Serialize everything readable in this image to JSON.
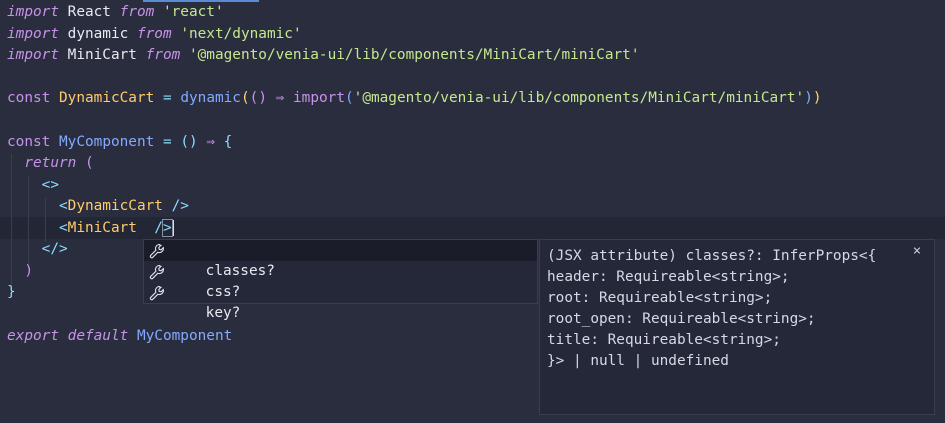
{
  "code": {
    "l1_kw": "import",
    "l1_name": "React",
    "l1_from": "from",
    "l1_str": "'react'",
    "l2_kw": "import",
    "l2_name": "dynamic",
    "l2_from": "from",
    "l2_str": "'next/dynamic'",
    "l3_kw": "import",
    "l3_name": "MiniCart",
    "l3_from": "from",
    "l3_str": "'@magento/venia-ui/lib/components/MiniCart/miniCart'",
    "l5_const": "const",
    "l5_name": "DynamicCart",
    "l5_eq": "=",
    "l5_fn": "dynamic",
    "l5_arrow": "⇒",
    "l5_import": "import",
    "l5_str": "'@magento/venia-ui/lib/components/MiniCart/miniCart'",
    "l7_const": "const",
    "l7_name": "MyComponent",
    "l7_eq": "=",
    "l7_parens": "()",
    "l7_arrow": "⇒",
    "l7_brace": "{",
    "l8_return": "return",
    "l8_paren": "(",
    "l9_frag": "<>",
    "l10_lt": "<",
    "l10_tag": "DynamicCart",
    "l10_close": "/>",
    "l11_lt": "<",
    "l11_tag": "MiniCart",
    "l11_slash": "/",
    "l11_gt": ">",
    "l12_frag": "</>",
    "l13_paren": ")",
    "l14_brace": "}",
    "l16_export": "export",
    "l16_default": "default",
    "l16_name": "MyComponent"
  },
  "suggestions": {
    "items": [
      {
        "label": "classes?",
        "icon": "wrench-icon"
      },
      {
        "label": "css?",
        "icon": "wrench-icon"
      },
      {
        "label": "key?",
        "icon": "wrench-icon"
      }
    ]
  },
  "details": {
    "lines": [
      "(JSX attribute) classes?: InferProps<{",
      "header: Requireable<string>;",
      "root: Requireable<string>;",
      "root_open: Requireable<string>;",
      "title: Requireable<string>;",
      "}> | null | undefined"
    ],
    "close": "×"
  },
  "colors": {
    "background": "#2a2d3e",
    "keyword": "#c792ea",
    "string": "#c3e88d",
    "identifier": "#ffcb6b",
    "function": "#82aaff",
    "operator": "#89ddff"
  }
}
